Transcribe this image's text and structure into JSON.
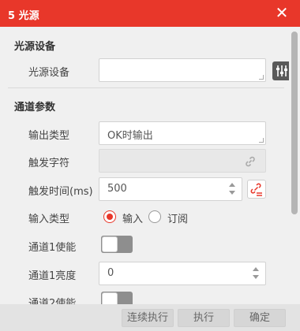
{
  "dialog": {
    "title": "5 光源",
    "close_glyph": "✕"
  },
  "light_source": {
    "section_title": "光源设备",
    "device_label": "光源设备",
    "device_value": "",
    "settings_icon": "sliders-icon"
  },
  "channel": {
    "section_title": "通道参数",
    "output_type_label": "输出类型",
    "output_type_value": "OK时输出",
    "trigger_char_label": "触发字符",
    "trigger_char_value": "",
    "trigger_time_label": "触发时间(ms)",
    "trigger_time_value": "500",
    "input_type_label": "输入类型",
    "input_type_options": [
      "输入",
      "订阅"
    ],
    "input_type_selected": "输入",
    "ch1_enable_label": "通道1使能",
    "ch1_enable_on": false,
    "ch1_brightness_label": "通道1亮度",
    "ch1_brightness_value": "0",
    "ch2_enable_label": "通道2使能",
    "ch2_enable_on": false
  },
  "footer": {
    "continuous_label": "连续执行",
    "execute_label": "执行",
    "confirm_label": "确定"
  },
  "colors": {
    "accent": "#e8372a",
    "titlebar": "#e8372a",
    "background": "#f0f0f0"
  }
}
